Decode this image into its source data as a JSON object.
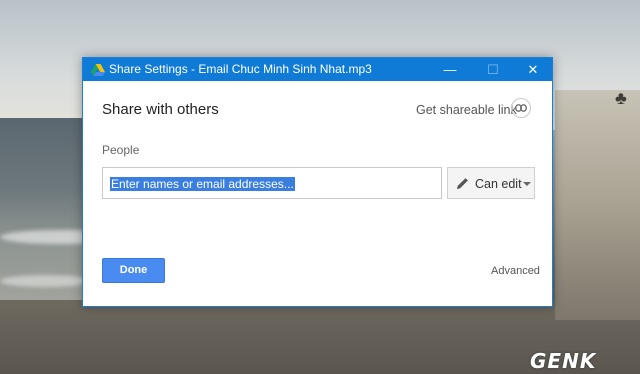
{
  "window": {
    "title": "Share Settings - Email Chuc Minh Sinh Nhat.mp3",
    "controls": {
      "minimize": "—",
      "maximize": "☐",
      "close": "✕"
    }
  },
  "dialog": {
    "heading": "Share with others",
    "shareable_link_label": "Get shareable link",
    "people_label": "People",
    "input_value": "Enter names or email addresses...",
    "permission_label": "Can edit",
    "done_label": "Done",
    "advanced_label": "Advanced"
  },
  "watermark": {
    "text": "GENK"
  },
  "colors": {
    "titlebar": "#0f7bd7",
    "done_button": "#4a8bf2",
    "selection": "#3a7fe0"
  },
  "icons": [
    "google-drive-icon",
    "link-icon",
    "pencil-icon",
    "caret-down-icon"
  ]
}
